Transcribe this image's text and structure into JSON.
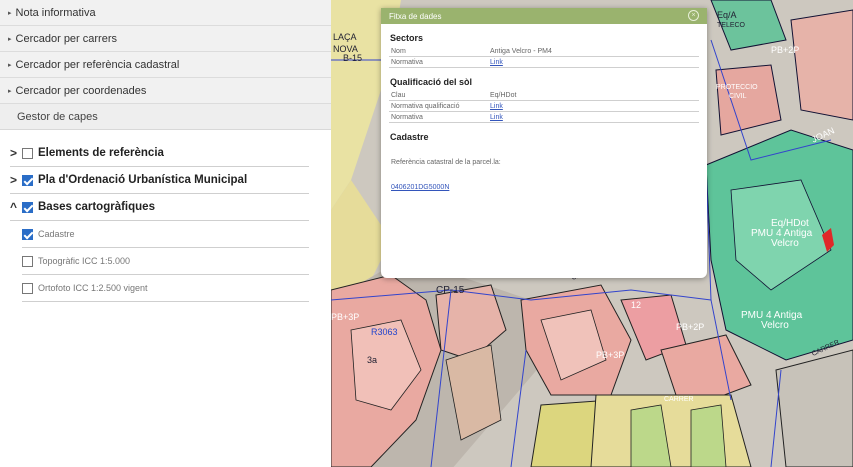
{
  "sidebar": {
    "accordions": [
      "Nota informativa",
      "Cercador per carrers",
      "Cercador per referència cadastral",
      "Cercador per coordenades"
    ],
    "layer_manager_title": "Gestor de capes",
    "layers": [
      {
        "label": "Elements de referència",
        "arrow": ">",
        "checked": false
      },
      {
        "label": "Pla d'Ordenació Urbanística Municipal",
        "arrow": ">",
        "checked": true
      },
      {
        "label": "Bases cartogràfiques",
        "arrow": "^",
        "checked": true
      }
    ],
    "sublayers": [
      {
        "label": "Cadastre",
        "checked": true
      },
      {
        "label": "Topogràfic ICC 1:5.000",
        "checked": false
      },
      {
        "label": "Ortofoto ICC 1:2.500 vigent",
        "checked": false
      }
    ]
  },
  "popup": {
    "title": "Fitxa de dades",
    "close_glyph": "×",
    "sectors": {
      "heading": "Sectors",
      "rows": [
        {
          "key": "Nom",
          "value": "Antiga Velcro - PM4"
        },
        {
          "key": "Normativa",
          "value": "Link"
        }
      ]
    },
    "qualificacio": {
      "heading": "Qualificació del sòl",
      "rows": [
        {
          "key": "Clau",
          "value": "Eq/HDot"
        },
        {
          "key": "Normativa qualificació",
          "value": "Link"
        },
        {
          "key": "Normativa",
          "value": "Link"
        }
      ]
    },
    "cadastre": {
      "heading": "Cadastre",
      "parcel_label": "Referència catastral de la parcel.la:",
      "parcel_ref": "0406201DG5000N"
    }
  },
  "map_labels": {
    "placa": "LAÇA",
    "nova": "NOVA",
    "b15": "B-15",
    "eq": "Eq/A",
    "teleco": "TELECO",
    "pb2p": "PB+2P",
    "protec": "PROTECCIO",
    "civil": "CIVIL",
    "joan": "JOAN",
    "eqhdot": "Eq/HDot",
    "pmu": "PMU 4 Antiga",
    "velcro": "Velcro",
    "cp15": "CP-15",
    "pb3p": "PB+3P",
    "r3063": "R3063",
    "carrer": "CARRER",
    "dotze": "12",
    "treisa": "3a",
    "pbr": "PB+2P",
    "pmu2": "PMU 4 Antiga",
    "velcro2": "Velcro",
    "carrer2": "CARRER",
    "carrer3": "CARRER",
    "pb3p2": "PB+3P"
  },
  "colors": {
    "popup_header": "#9ab36e",
    "check_on": "#2a6dc7",
    "link": "#3355bb"
  }
}
